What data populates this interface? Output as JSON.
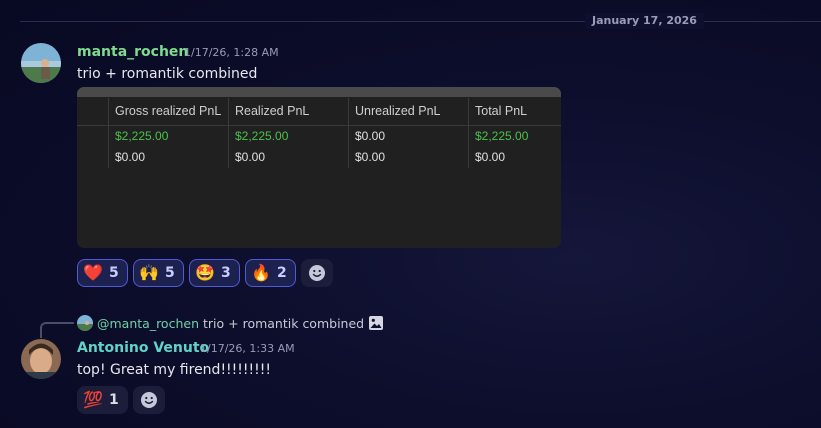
{
  "date_divider": "January 17, 2026",
  "message1": {
    "username": "manta_rochen",
    "timestamp": "1/17/26, 1:28 AM",
    "text": "trio + romantik combined",
    "embed_table": {
      "headers": [
        "Gross realized PnL",
        "Realized PnL",
        "Unrealized PnL",
        "Total PnL"
      ],
      "rows": [
        [
          "$2,225.00",
          "$2,225.00",
          "$0.00",
          "$2,225.00"
        ],
        [
          "$0.00",
          "$0.00",
          "$0.00",
          "$0.00"
        ]
      ]
    },
    "reactions": [
      {
        "icon": "red-heart",
        "emoji": "❤️",
        "count": "5"
      },
      {
        "icon": "raising-hands",
        "emoji": "🙌",
        "count": "5"
      },
      {
        "icon": "star-struck",
        "emoji": "🤩",
        "count": "3"
      },
      {
        "icon": "fire",
        "emoji": "🔥",
        "count": "2"
      }
    ]
  },
  "message2": {
    "reply": {
      "mention": "@manta_rochen",
      "preview": "trio + romantik combined"
    },
    "username": "Antonino Venuto",
    "timestamp": "1/17/26, 1:33 AM",
    "text": "top! Great my firend!!!!!!!!!",
    "reactions": [
      {
        "icon": "hundred-points",
        "emoji": "💯",
        "count": "1"
      }
    ]
  },
  "colors": {
    "positive": "#4cc24a",
    "username1": "#7ddc8e",
    "username2": "#5fd4c8",
    "reaction_border": "#4f5ad6"
  }
}
